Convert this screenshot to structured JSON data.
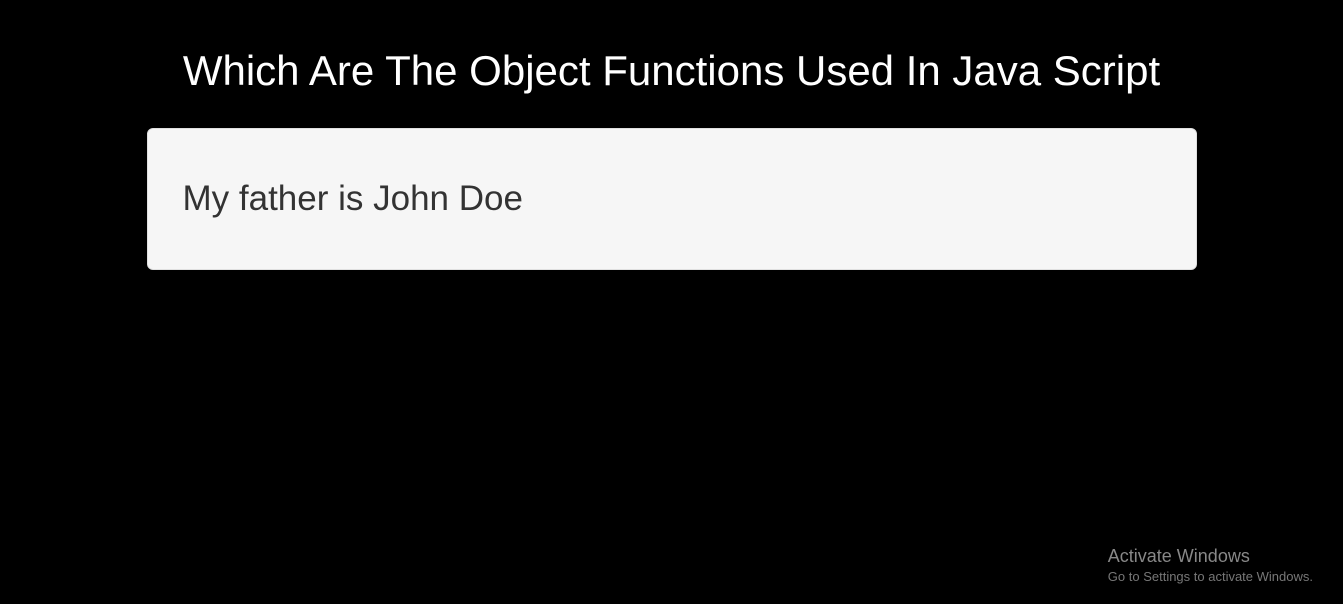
{
  "page": {
    "heading": "Which Are The Object Functions Used In Java Script"
  },
  "panel": {
    "text": "My father is John Doe"
  },
  "watermark": {
    "title": "Activate Windows",
    "subtitle": "Go to Settings to activate Windows."
  }
}
